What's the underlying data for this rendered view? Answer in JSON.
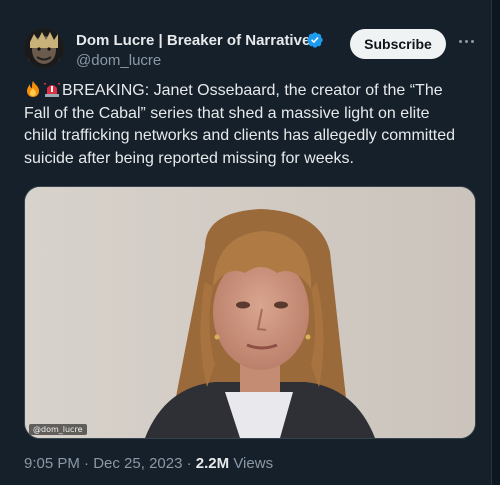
{
  "author": {
    "name": "Dom Lucre | Breaker of Narratives",
    "handle": "@dom_lucre",
    "verified_color": "#1d9bf0"
  },
  "actions": {
    "subscribe_label": "Subscribe",
    "more_icon": "more-horizontal-icon"
  },
  "post": {
    "emojis": [
      "fire-emoji",
      "police-light-emoji"
    ],
    "text": "BREAKING: Janet Ossebaard, the creator of the “The Fall of the Cabal” series that shed a massive light on elite child trafficking networks and clients has allegedly committed suicide after being reported missing for weeks."
  },
  "media": {
    "watermark": "@dom_lucre"
  },
  "meta": {
    "time": "9:05 PM",
    "separator1": " · ",
    "date": "Dec 25, 2023",
    "separator2": " · ",
    "views_count": "2.2M",
    "views_label": " Views"
  },
  "colors": {
    "background": "#15202b",
    "text_primary": "#e7e9ea",
    "text_secondary": "#8b98a5",
    "accent": "#1d9bf0"
  }
}
